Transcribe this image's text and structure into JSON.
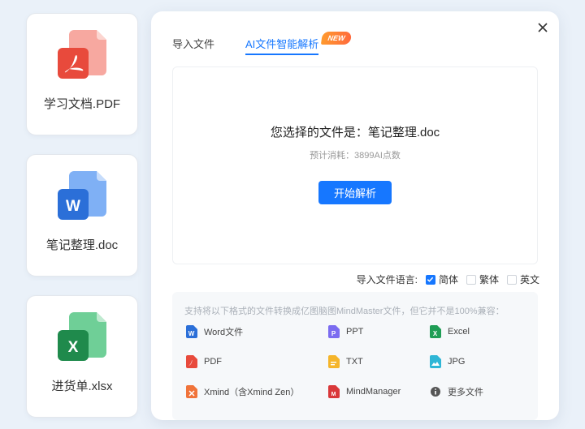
{
  "cards": [
    {
      "name": "学习文档.PDF",
      "icon": "pdf-file-icon",
      "color": "#e84a3c"
    },
    {
      "name": "笔记整理.doc",
      "icon": "word-file-icon",
      "color": "#2b6fd8"
    },
    {
      "name": "进货单.xlsx",
      "icon": "excel-file-icon",
      "color": "#1f9d55"
    }
  ],
  "dialog": {
    "close_icon": "close-icon",
    "tabs": [
      {
        "label": "导入文件",
        "active": false
      },
      {
        "label": "AI文件智能解析",
        "active": true,
        "badge": "NEW"
      }
    ],
    "selected_file_text": "您选择的文件是：笔记整理.doc",
    "cost_text": "预计消耗：3899AI点数",
    "start_button": "开始解析",
    "language": {
      "label": "导入文件语言:",
      "options": [
        {
          "label": "简体",
          "checked": true
        },
        {
          "label": "繁体",
          "checked": false
        },
        {
          "label": "英文",
          "checked": false
        }
      ]
    },
    "formats": {
      "description": "支持将以下格式的文件转换成亿图脑图MindMaster文件，但它并不是100%兼容：",
      "items": [
        {
          "label": "Word文件",
          "icon": "word-icon",
          "color": "#2b6fd8"
        },
        {
          "label": "PPT",
          "icon": "ppt-icon",
          "color": "#7b6cf0"
        },
        {
          "label": "Excel",
          "icon": "excel-icon",
          "color": "#1f9d55"
        },
        {
          "label": "PDF",
          "icon": "pdf-icon",
          "color": "#e84a3c"
        },
        {
          "label": "TXT",
          "icon": "txt-icon",
          "color": "#f5b52a"
        },
        {
          "label": "JPG",
          "icon": "jpg-icon",
          "color": "#2fb6d6"
        },
        {
          "label": "Xmind（含Xmind Zen）",
          "icon": "xmind-icon",
          "color": "#f0733a"
        },
        {
          "label": "MindManager",
          "icon": "mindmanager-icon",
          "color": "#d9383a"
        },
        {
          "label": "更多文件",
          "icon": "more-files-icon",
          "color": "#555555"
        }
      ]
    }
  },
  "colors": {
    "accent": "#1677ff",
    "background": "#eaf1f9"
  }
}
